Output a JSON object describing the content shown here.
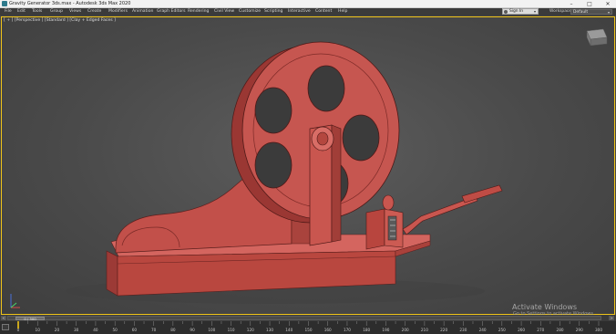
{
  "window": {
    "title": "Gravity Generator 3ds.max - Autodesk 3ds Max 2020",
    "minimize": "–",
    "maximize": "□",
    "close": "✕"
  },
  "menu": [
    "File",
    "Edit",
    "Tools",
    "Group",
    "Views",
    "Create",
    "Modifiers",
    "Animation",
    "Graph Editors",
    "Rendering",
    "Civil View",
    "Customize",
    "Scripting",
    "Interactive",
    "Content",
    "Help"
  ],
  "account": {
    "sign_in": "Sign In",
    "arrow": "▾"
  },
  "workspace": {
    "label": "Workspaces:",
    "value": "Default",
    "arrow": "▾"
  },
  "viewport": {
    "label": "[ + ] [Perspective ] [Standard ] [Clay + Edged Faces ]",
    "model_color": "#c0504b",
    "background_color": "#4e4e4e"
  },
  "watermark": {
    "title": "Activate Windows",
    "subtitle": "Go to Settings to activate Windows."
  },
  "timeline": {
    "frame_display": "0 / 300",
    "current_frame": 0,
    "total_frames": 300,
    "prev_label": "<",
    "next_label": ">",
    "ticks": [
      "0",
      "10",
      "20",
      "30",
      "40",
      "50",
      "60",
      "70",
      "80",
      "90",
      "100",
      "110",
      "120",
      "130",
      "140",
      "150",
      "160",
      "170",
      "180",
      "190",
      "200",
      "210",
      "220",
      "230",
      "240",
      "250",
      "260",
      "270",
      "280",
      "290",
      "300"
    ]
  }
}
